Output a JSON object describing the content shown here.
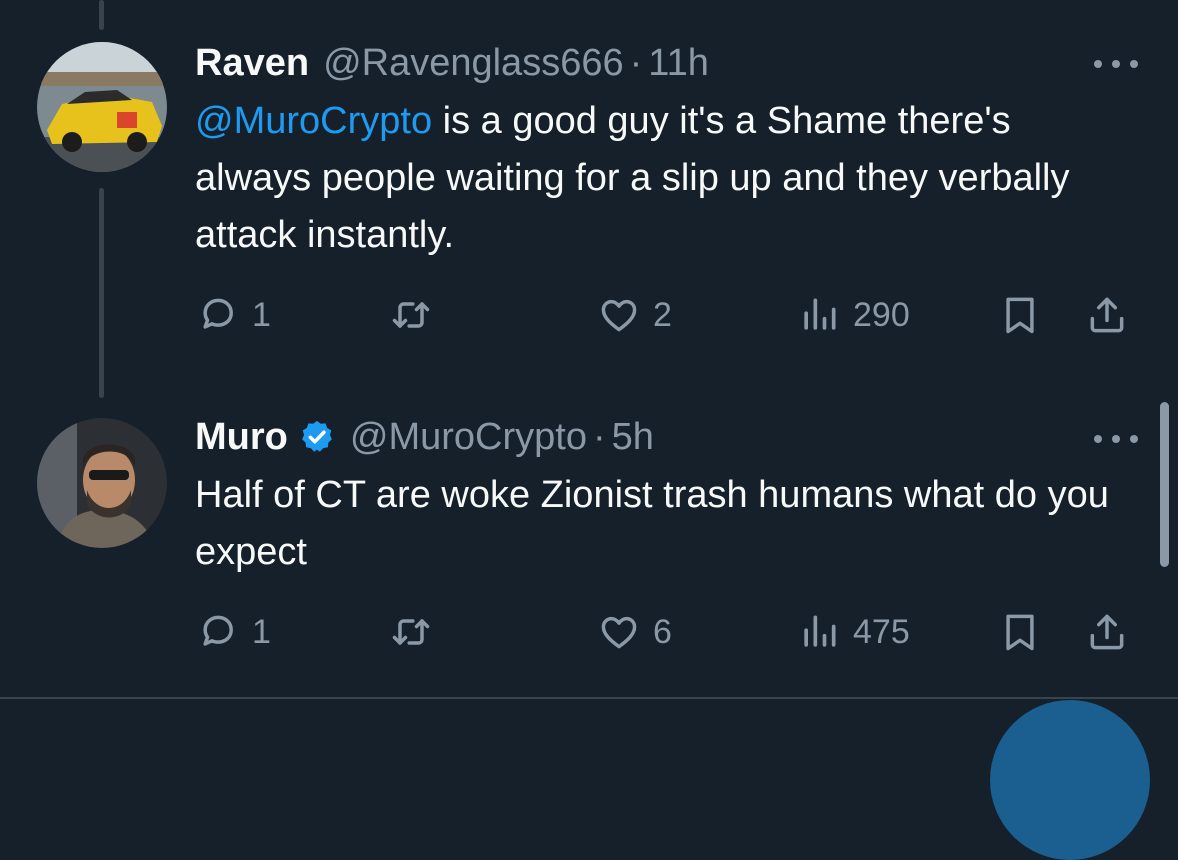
{
  "tweets": [
    {
      "name": "Raven",
      "handle": "@Ravenglass666",
      "separator": "·",
      "time": "11h",
      "mention": "@MuroCrypto",
      "text": " is a good guy it's a Shame there's always people waiting for a slip up and they verbally attack instantly.",
      "replies": "1",
      "retweets": "",
      "likes": "2",
      "views": "290"
    },
    {
      "name": "Muro",
      "handle": "@MuroCrypto",
      "separator": "·",
      "time": "5h",
      "text": "Half of CT are woke Zionist trash humans what do you expect",
      "replies": "1",
      "retweets": "",
      "likes": "6",
      "views": "475",
      "verified": true
    }
  ],
  "colors": {
    "background": "#15202b",
    "text": "#f7f9f9",
    "muted": "#8b98a5",
    "accent": "#1d9bf0",
    "divider": "#38444d"
  },
  "icons": [
    "reply-icon",
    "retweet-icon",
    "like-icon",
    "views-icon",
    "bookmark-icon",
    "share-icon",
    "more-icon",
    "verified-badge-icon"
  ]
}
